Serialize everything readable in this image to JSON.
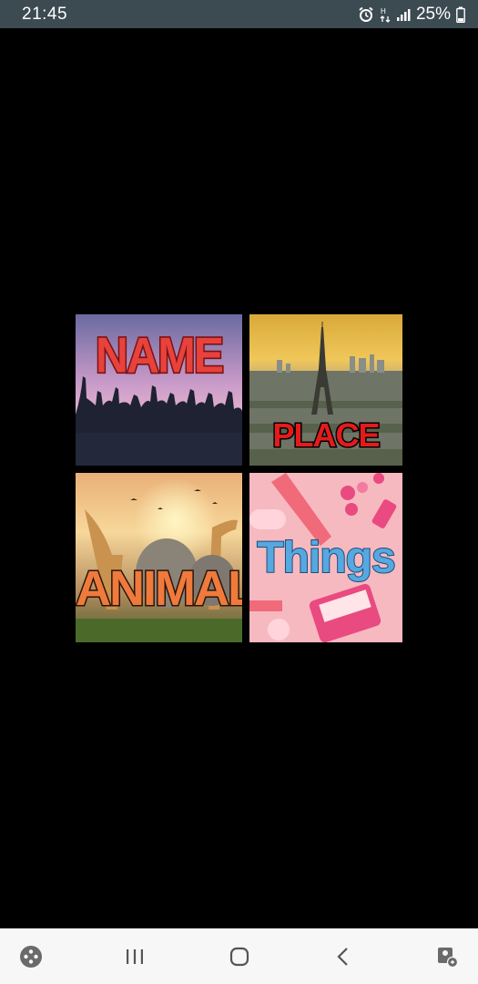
{
  "status_bar": {
    "time": "21:45",
    "battery_percent": "25%",
    "icons": [
      "alarm-icon",
      "data-icon",
      "signal-icon",
      "battery-icon"
    ]
  },
  "tiles": [
    {
      "id": "name",
      "label": "NAME"
    },
    {
      "id": "place",
      "label": "PLACE"
    },
    {
      "id": "animal",
      "label": "ANIMAL"
    },
    {
      "id": "things",
      "label": "Things"
    }
  ],
  "nav_bar": {
    "buttons": [
      "game-launcher-icon",
      "recent-apps-icon",
      "home-icon",
      "back-icon",
      "screen-assistant-icon"
    ]
  },
  "colors": {
    "status_bar_bg": "#3c4a52",
    "background": "#000000",
    "nav_bar_bg": "#f7f7f7",
    "name_label": "#e8423c",
    "place_label": "#e51a1a",
    "animal_label": "#f07a3c",
    "things_label": "#56a9e0"
  }
}
